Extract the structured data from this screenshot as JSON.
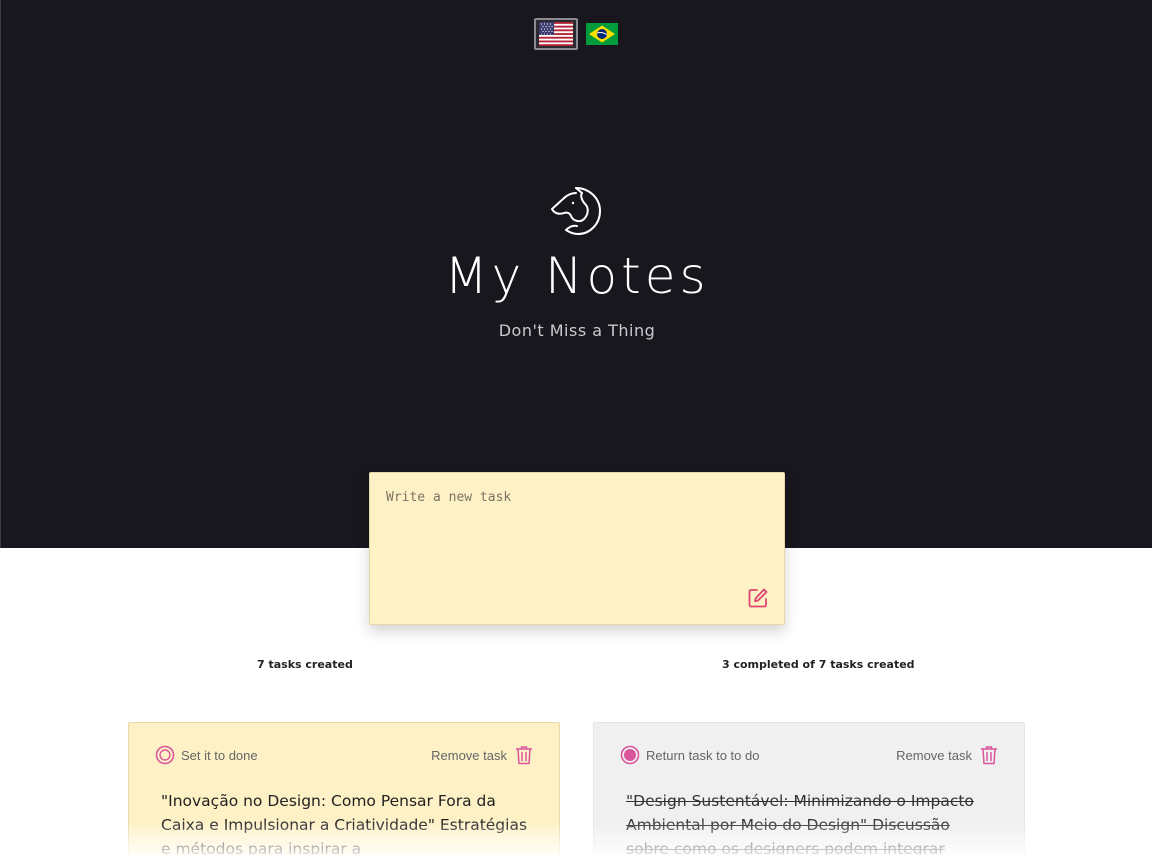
{
  "language_switcher": {
    "options": [
      {
        "code": "en",
        "icon": "us-flag-icon",
        "active": true
      },
      {
        "code": "pt-BR",
        "icon": "brazil-flag-icon",
        "active": false
      }
    ]
  },
  "header": {
    "logo_icon": "horse-head-icon",
    "title": "My Notes",
    "subtitle": "Don't Miss a Thing"
  },
  "composer": {
    "placeholder": "Write a new task",
    "value": "",
    "submit_icon": "edit-icon"
  },
  "stats": {
    "created_text": "7 tasks created",
    "completed_text": "3 completed of 7 tasks created"
  },
  "tasks": [
    {
      "status_label": "Set it to done",
      "status_icon": "radio-unchecked-icon",
      "remove_label": "Remove task",
      "remove_icon": "trash-icon",
      "text": "\"Inovação no Design: Como Pensar Fora da Caixa e Impulsionar a Criatividade\" Estratégias e métodos para inspirar a",
      "done": false
    },
    {
      "status_label": "Return task to to do",
      "status_icon": "radio-checked-icon",
      "remove_label": "Remove task",
      "remove_icon": "trash-icon",
      "text": "\"Design Sustentável: Minimizando o Impacto Ambiental por Meio do Design\" Discussão sobre como os designers podem integrar",
      "done": true
    }
  ],
  "colors": {
    "hero_bg": "#18171d",
    "note_yellow": "#fff1c6",
    "done_gray": "#f0f0f0",
    "accent_pink": "#d9569d"
  }
}
